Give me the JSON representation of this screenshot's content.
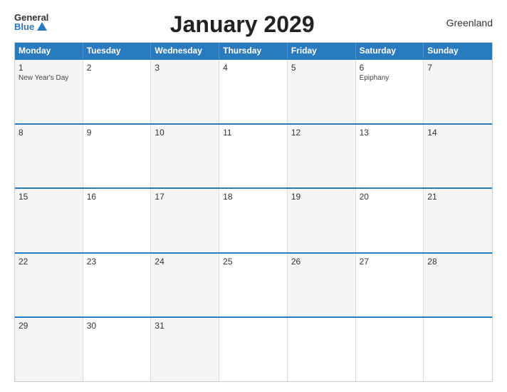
{
  "header": {
    "logo_general": "General",
    "logo_blue": "Blue",
    "title": "January 2029",
    "region": "Greenland"
  },
  "calendar": {
    "day_headers": [
      "Monday",
      "Tuesday",
      "Wednesday",
      "Thursday",
      "Friday",
      "Saturday",
      "Sunday"
    ],
    "weeks": [
      [
        {
          "num": "1",
          "event": "New Year's Day"
        },
        {
          "num": "2",
          "event": ""
        },
        {
          "num": "3",
          "event": ""
        },
        {
          "num": "4",
          "event": ""
        },
        {
          "num": "5",
          "event": ""
        },
        {
          "num": "6",
          "event": "Epiphany"
        },
        {
          "num": "7",
          "event": ""
        }
      ],
      [
        {
          "num": "8",
          "event": ""
        },
        {
          "num": "9",
          "event": ""
        },
        {
          "num": "10",
          "event": ""
        },
        {
          "num": "11",
          "event": ""
        },
        {
          "num": "12",
          "event": ""
        },
        {
          "num": "13",
          "event": ""
        },
        {
          "num": "14",
          "event": ""
        }
      ],
      [
        {
          "num": "15",
          "event": ""
        },
        {
          "num": "16",
          "event": ""
        },
        {
          "num": "17",
          "event": ""
        },
        {
          "num": "18",
          "event": ""
        },
        {
          "num": "19",
          "event": ""
        },
        {
          "num": "20",
          "event": ""
        },
        {
          "num": "21",
          "event": ""
        }
      ],
      [
        {
          "num": "22",
          "event": ""
        },
        {
          "num": "23",
          "event": ""
        },
        {
          "num": "24",
          "event": ""
        },
        {
          "num": "25",
          "event": ""
        },
        {
          "num": "26",
          "event": ""
        },
        {
          "num": "27",
          "event": ""
        },
        {
          "num": "28",
          "event": ""
        }
      ],
      [
        {
          "num": "29",
          "event": ""
        },
        {
          "num": "30",
          "event": ""
        },
        {
          "num": "31",
          "event": ""
        },
        {
          "num": "",
          "event": ""
        },
        {
          "num": "",
          "event": ""
        },
        {
          "num": "",
          "event": ""
        },
        {
          "num": "",
          "event": ""
        }
      ]
    ]
  }
}
